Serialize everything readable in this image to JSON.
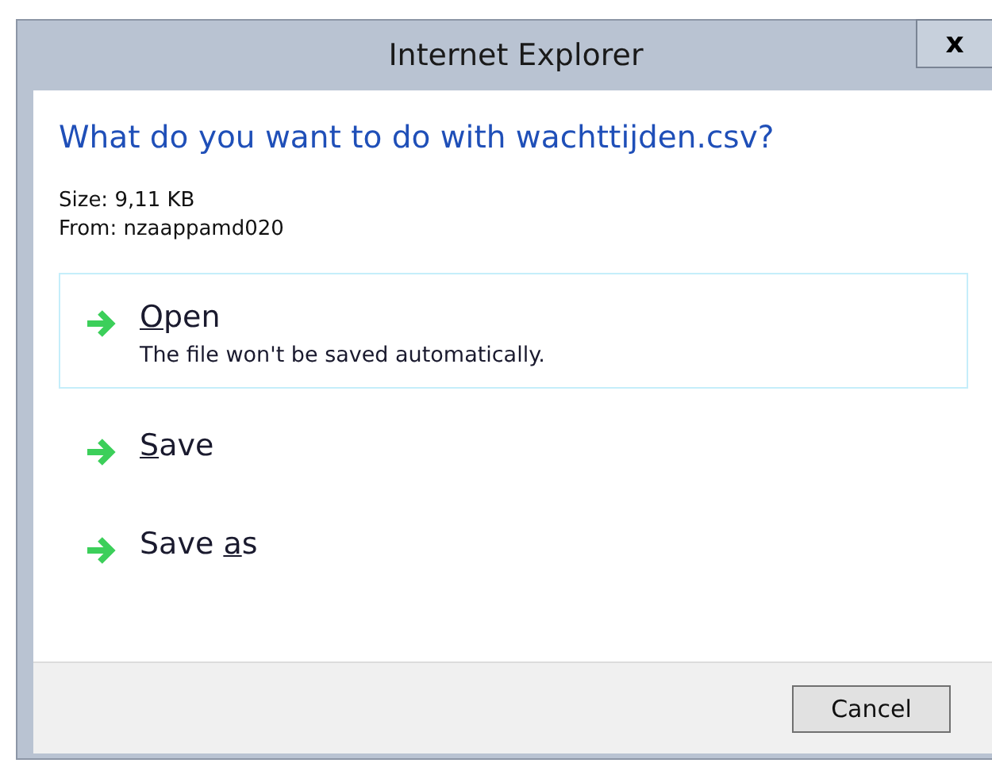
{
  "window": {
    "title": "Internet Explorer",
    "close": "x"
  },
  "heading": "What do you want to do with wachttijden.csv?",
  "details": [
    "Size: 9,11 KB",
    "From: nzaappamd020"
  ],
  "options": [
    {
      "key": "O",
      "after": "pen",
      "description": "The file won't be saved automatically.",
      "selected": true
    },
    {
      "key": "S",
      "after": "ave",
      "selected": false
    },
    {
      "before": "Save ",
      "key": "a",
      "after": "s",
      "selected": false
    }
  ],
  "buttons": [
    "Cancel"
  ]
}
